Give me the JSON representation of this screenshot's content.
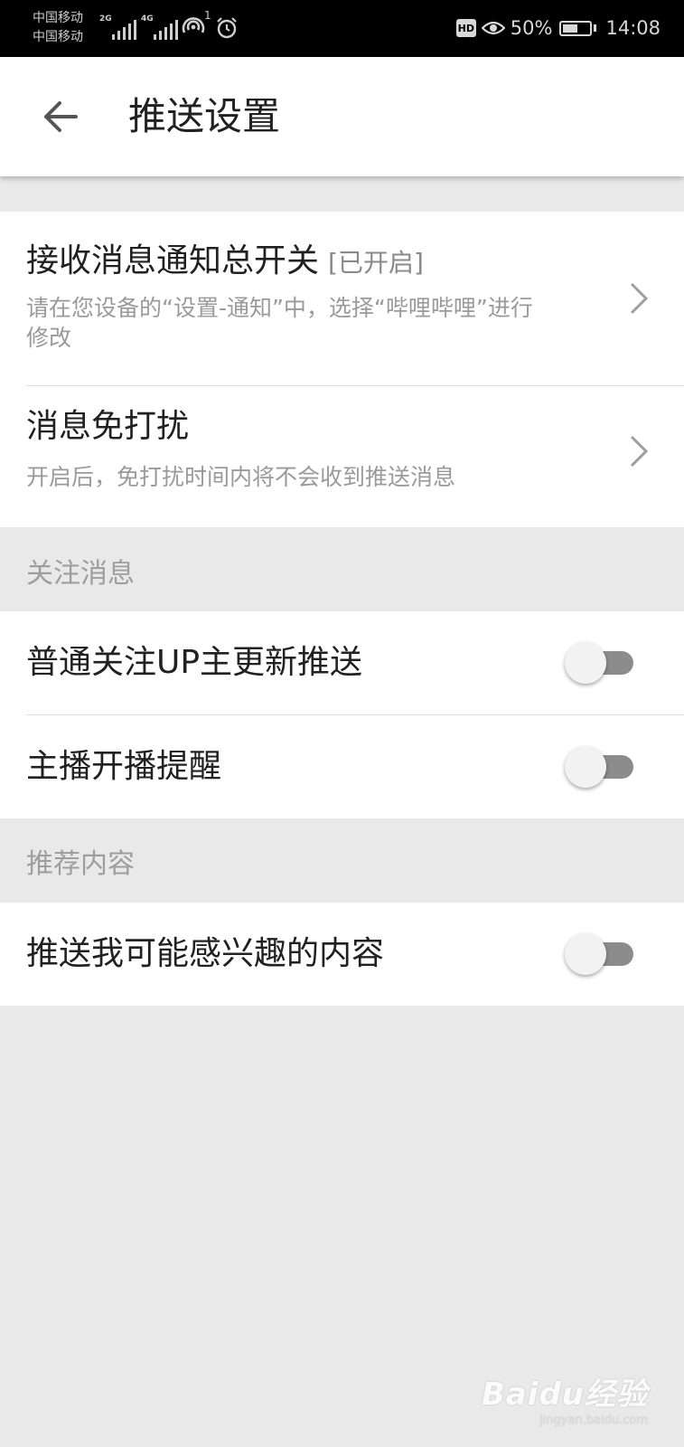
{
  "status_bar": {
    "carrier_1": "中国移动",
    "carrier_2": "中国移动",
    "network_1": "2G",
    "network_2": "4G",
    "hotspot_count": "1",
    "hd_badge": "HD",
    "battery": "50%",
    "time": "14:08"
  },
  "header": {
    "back_icon": "arrow-left-icon",
    "title": "推送设置"
  },
  "settings": {
    "master_switch": {
      "title": "接收消息通知总开关",
      "state": "[已开启]",
      "desc": "请在您设备的“设置-通知”中，选择“哔哩哔哩”进行修改"
    },
    "dnd": {
      "title": "消息免打扰",
      "desc": "开启后，免打扰时间内将不会收到推送消息"
    }
  },
  "sections": {
    "follow": {
      "label": "关注消息",
      "items": [
        {
          "label": "普通关注UP主更新推送",
          "enabled": false
        },
        {
          "label": "主播开播提醒",
          "enabled": false
        }
      ]
    },
    "recommend": {
      "label": "推荐内容",
      "items": [
        {
          "label": "推送我可能感兴趣的内容",
          "enabled": false
        }
      ]
    }
  },
  "watermark": {
    "logo": "Baidu经验",
    "url": "jingyan.baidu.com"
  },
  "colors": {
    "toggle_track_off": "#8c8c8c",
    "toggle_knob_off": "#f2f2f2",
    "background": "#e9e9e9"
  }
}
